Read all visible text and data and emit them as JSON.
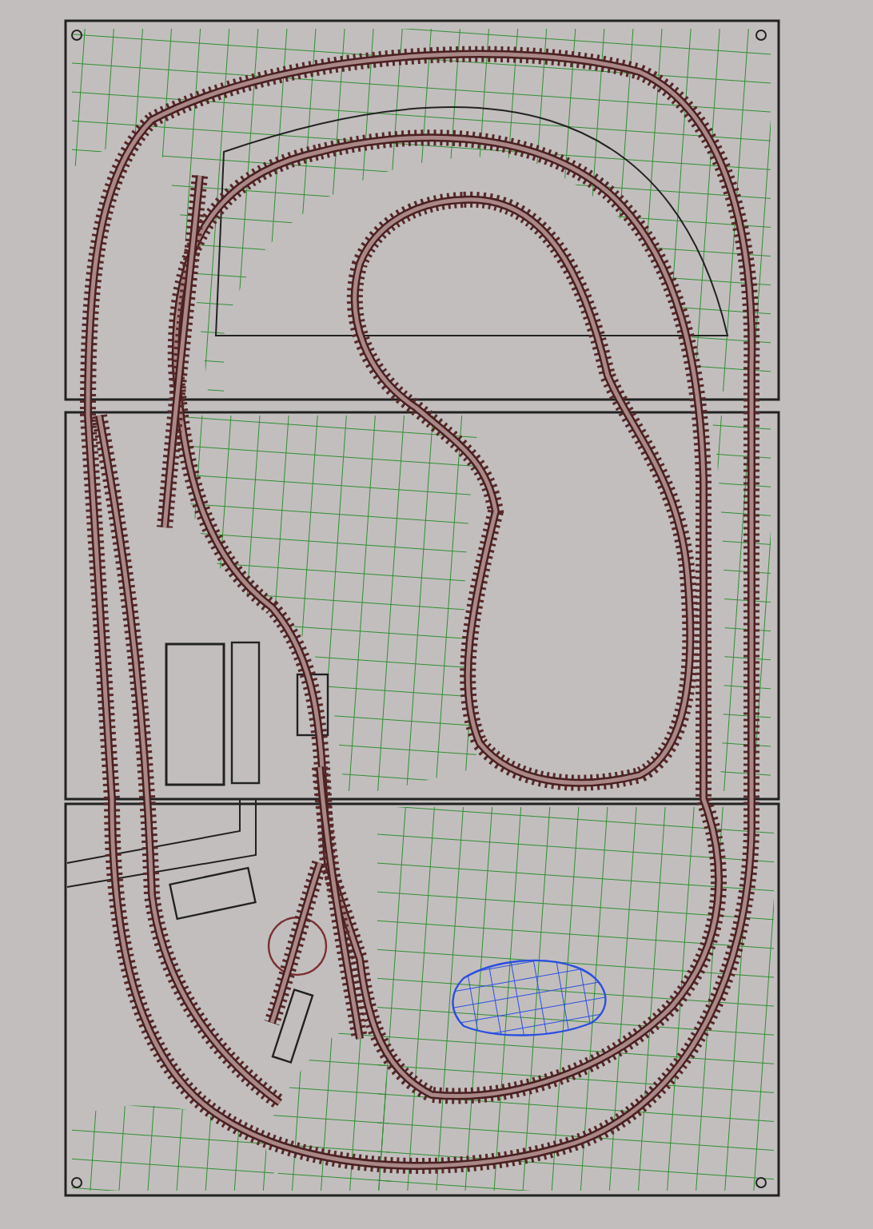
{
  "drawing": {
    "kind": "track-plan"
  }
}
